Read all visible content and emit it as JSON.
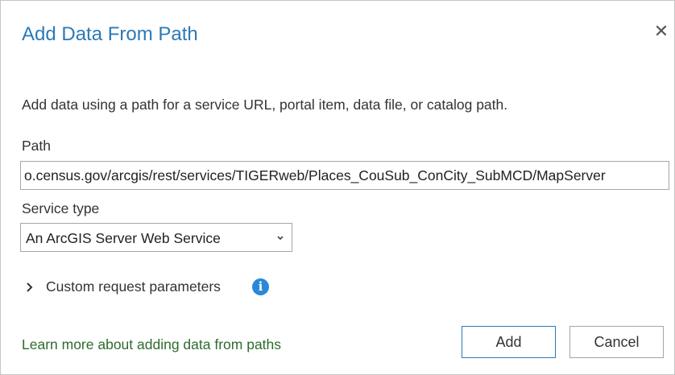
{
  "dialog": {
    "title": "Add Data From Path",
    "close_icon": "close-icon",
    "description": "Add data using a path for a service URL, portal item, data file, or catalog path.",
    "path": {
      "label": "Path",
      "value": "o.census.gov/arcgis/rest/services/TIGERweb/Places_CouSub_ConCity_SubMCD/MapServer"
    },
    "service_type": {
      "label": "Service type",
      "selected": "An ArcGIS Server Web Service",
      "arrow_icon": "dropdown-arrow-icon"
    },
    "custom_params": {
      "label": "Custom request parameters",
      "expander_icon": "chevron-right-icon",
      "info_icon": "info-icon"
    },
    "learn_more_link": "Learn more about adding data from paths",
    "buttons": {
      "add": "Add",
      "cancel": "Cancel"
    },
    "colors": {
      "title": "#2a7ab8",
      "link": "#2e6b2e",
      "info": "#2a88d8",
      "primary_border": "#2a7ab8"
    }
  }
}
